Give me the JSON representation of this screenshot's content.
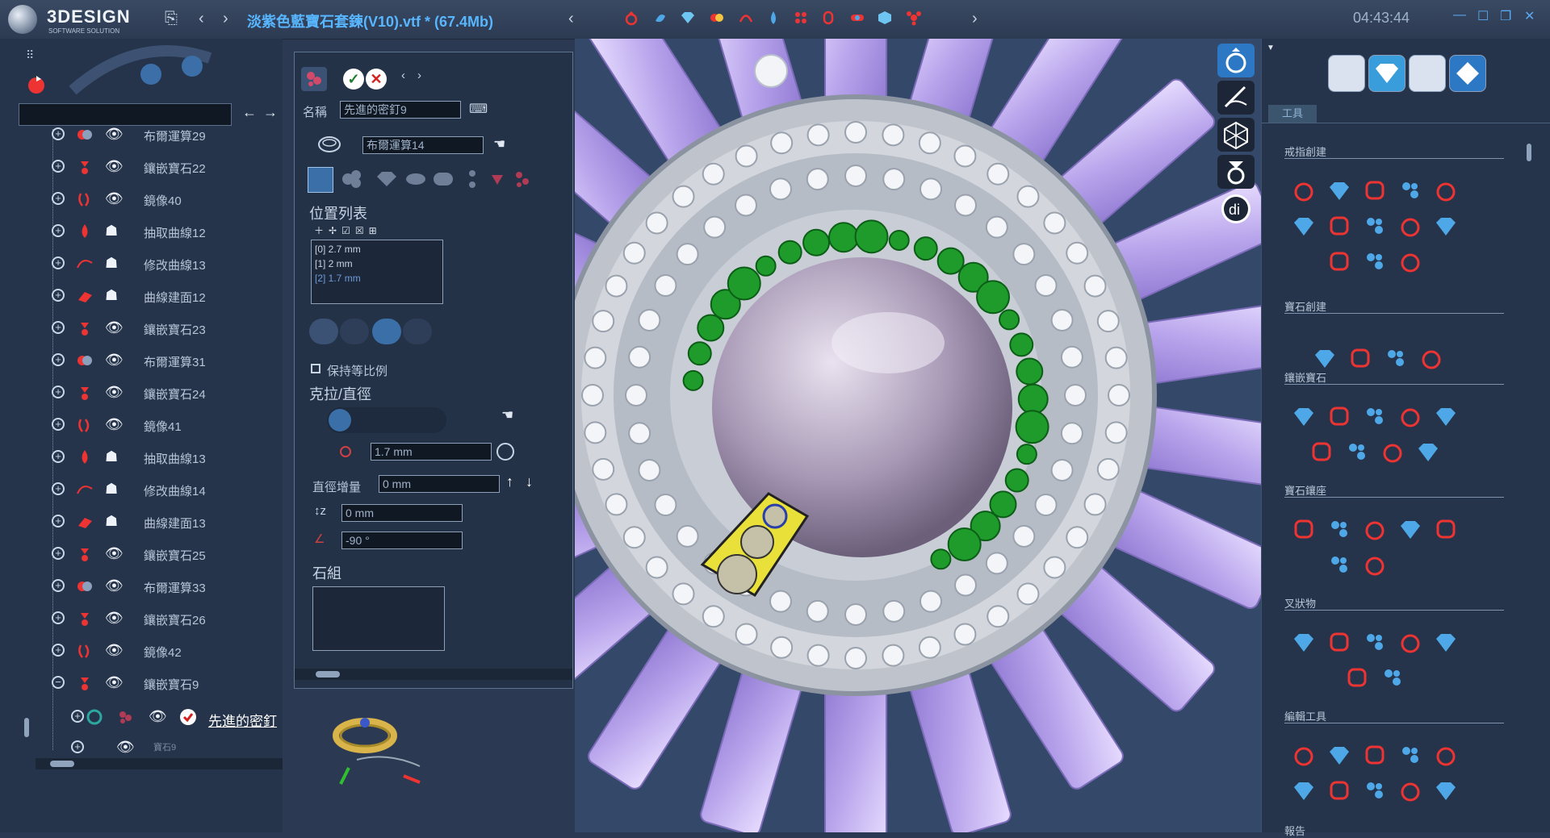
{
  "app": {
    "logo_name": "3DESIGN",
    "logo_sub": "SOFTWARE SOLUTION",
    "title": "淡紫色藍寶石套鍊(V10).vtf *  (67.4Mb)",
    "clock": "04:43:44"
  },
  "tree": {
    "items": [
      {
        "label": "布爾運算29"
      },
      {
        "label": "鑲嵌寶石22"
      },
      {
        "label": "鏡像40"
      },
      {
        "label": "抽取曲線12"
      },
      {
        "label": "修改曲線13"
      },
      {
        "label": "曲線建面12"
      },
      {
        "label": "鑲嵌寶石23"
      },
      {
        "label": "布爾運算31"
      },
      {
        "label": "鑲嵌寶石24"
      },
      {
        "label": "鏡像41"
      },
      {
        "label": "抽取曲線13"
      },
      {
        "label": "修改曲線14"
      },
      {
        "label": "曲線建面13"
      },
      {
        "label": "鑲嵌寶石25"
      },
      {
        "label": "布爾運算33"
      },
      {
        "label": "鑲嵌寶石26"
      },
      {
        "label": "鏡像42"
      },
      {
        "label": "鑲嵌寶石9"
      }
    ],
    "child_label": "先進的密釘",
    "sub_child_label": "寶石9"
  },
  "props": {
    "name_label": "名稱",
    "name_value": "先進的密釘9",
    "source_value": "布爾運算14",
    "position_list_title": "位置列表",
    "position_items": [
      "[0]  2.7 mm",
      "[1]  2 mm",
      "[2]  1.7 mm"
    ],
    "keep_ratio_label": "保持等比例",
    "carat_title": "克拉/直徑",
    "diameter_value": "1.7 mm",
    "increment_label": "直徑增量",
    "increment_value": "0 mm",
    "z_value": "0 mm",
    "angle_value": "-90 °",
    "stone_group_title": "石組"
  },
  "tools": {
    "tab_label": "工具",
    "sections": [
      "戒指創建",
      "寶石創建",
      "鑲嵌寶石",
      "寶石鑲座",
      "叉狀物",
      "編輯工具",
      "報告"
    ]
  },
  "colors": {
    "title_blue": "#58b6ff",
    "accent": "#3a9ddb",
    "gem_lavender": "#c8b8ee",
    "gem_green": "#1f9b2c",
    "gem_purple": "#5a1db8",
    "metal": "#cfd3da"
  }
}
